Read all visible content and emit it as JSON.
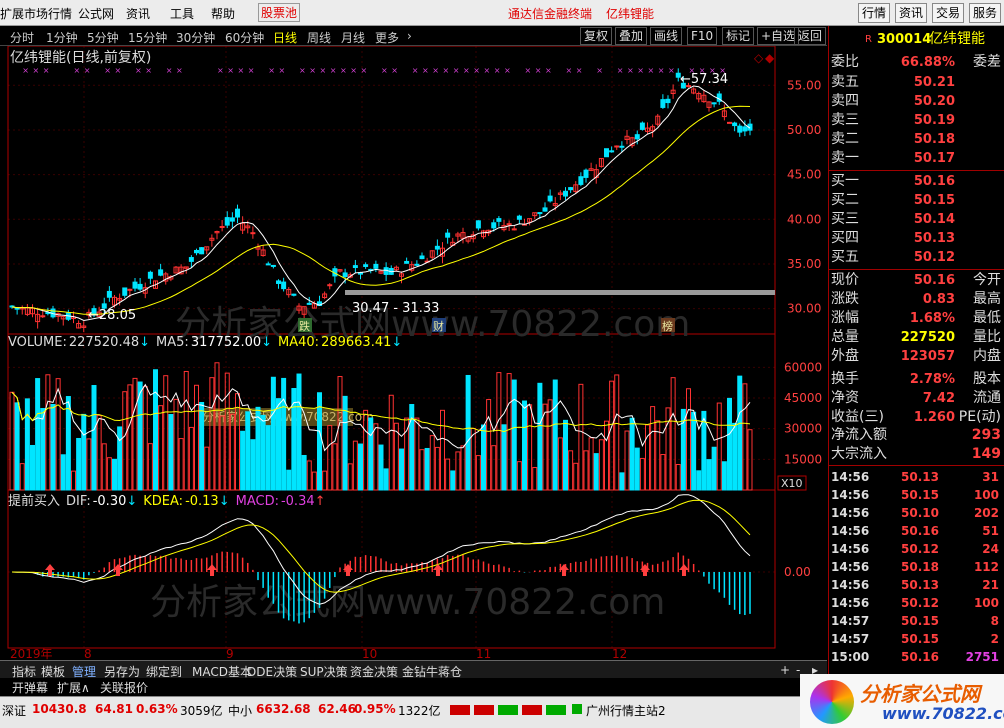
{
  "menu": {
    "items": [
      "扩展市场行情",
      "公式网",
      "资讯",
      "工具",
      "帮助"
    ],
    "hot": "股票池",
    "center_title": "通达信金融终端",
    "center_stock": "亿纬锂能",
    "right_buttons": [
      "行情",
      "资讯",
      "交易",
      "服务"
    ]
  },
  "periods": {
    "items": [
      "分时",
      "1分钟",
      "5分钟",
      "15分钟",
      "30分钟",
      "60分钟",
      "日线",
      "周线",
      "月线",
      "更多"
    ],
    "active": "日线"
  },
  "toolbar": {
    "buttons": [
      "复权",
      "叠加",
      "画线",
      "F10",
      "标记",
      "+自选",
      "返回"
    ]
  },
  "chart": {
    "title": "亿纬锂能(日线,前复权)",
    "high_label": "57.34",
    "low_label": "28.05",
    "range_label": "30.47 - 31.33",
    "marks": [
      "跌",
      "财",
      "榜"
    ],
    "y_ticks": [
      "55.00",
      "50.00",
      "45.00",
      "40.00",
      "35.00",
      "30.00"
    ],
    "watermark": "分析家公式网www.70822.com",
    "watermark_small": "分析家公式网www.70822.com"
  },
  "volume": {
    "label": "VOLUME:",
    "value": "227520.48",
    "ma5_label": "MA5:",
    "ma5": "317752.00",
    "ma40_label": "MA40:",
    "ma40": "289663.41",
    "y_ticks": [
      "60000",
      "45000",
      "30000",
      "15000"
    ],
    "unit": "X10"
  },
  "macd": {
    "title": "提前买入",
    "dif_label": "DIF:",
    "dif": "-0.30",
    "dea_label": "KDEA:",
    "dea": "-0.13",
    "macd_label": "MACD:",
    "macd": "-0.34",
    "y_tick": "0.00"
  },
  "timeline": {
    "labels": [
      "2019年",
      "8",
      "9",
      "10",
      "11",
      "12"
    ]
  },
  "bottom_tabs": {
    "items": [
      "指标",
      "模板",
      "管理",
      "另存为",
      "绑定到",
      "MACD基本",
      "DDE决策",
      "SUP决策",
      "资金决策",
      "金钻牛蒋仓"
    ]
  },
  "bottom2": {
    "items": [
      "开弹幕",
      "扩展∧",
      "关联报价"
    ]
  },
  "status": {
    "sz_label": "深证",
    "sz_value": "10430.8",
    "sz_change": "64.81",
    "sz_pct": "0.63%",
    "sz_amount": "3059亿",
    "zx_label": "中小",
    "zx_value": "6632.68",
    "zx_change": "62.46",
    "zx_pct": "0.95%",
    "zx_amount": "1322亿",
    "server": "广州行情主站2"
  },
  "quote": {
    "code": "300014",
    "name": "亿纬锂能",
    "wei_bi_label": "委比",
    "wei_bi": "66.88%",
    "wei_cha_label": "委差",
    "sells": [
      {
        "label": "卖五",
        "price": "50.21"
      },
      {
        "label": "卖四",
        "price": "50.20"
      },
      {
        "label": "卖三",
        "price": "50.19"
      },
      {
        "label": "卖二",
        "price": "50.18"
      },
      {
        "label": "卖一",
        "price": "50.17"
      }
    ],
    "buys": [
      {
        "label": "买一",
        "price": "50.16"
      },
      {
        "label": "买二",
        "price": "50.15"
      },
      {
        "label": "买三",
        "price": "50.14"
      },
      {
        "label": "买四",
        "price": "50.13"
      },
      {
        "label": "买五",
        "price": "50.12"
      }
    ],
    "stats": [
      {
        "l": "现价",
        "v": "50.16",
        "r": "今开"
      },
      {
        "l": "涨跌",
        "v": "0.83",
        "r": "最高"
      },
      {
        "l": "涨幅",
        "v": "1.68%",
        "r": "最低"
      },
      {
        "l": "总量",
        "v": "227520",
        "r": "量比"
      },
      {
        "l": "外盘",
        "v": "123057",
        "r": "内盘"
      },
      {
        "l": "换手",
        "v": "2.78%",
        "r": "股本"
      },
      {
        "l": "净资",
        "v": "7.42",
        "r": "流通"
      },
      {
        "l": "收益(三)",
        "v": "1.260",
        "r": "PE(动)"
      }
    ],
    "flow": [
      {
        "l": "净流入额",
        "v": "293"
      },
      {
        "l": "大宗流入",
        "v": "149"
      }
    ],
    "ticks": [
      {
        "t": "14:56",
        "p": "50.13",
        "v": "31"
      },
      {
        "t": "14:56",
        "p": "50.15",
        "v": "100"
      },
      {
        "t": "14:56",
        "p": "50.10",
        "v": "202"
      },
      {
        "t": "14:56",
        "p": "50.16",
        "v": "51"
      },
      {
        "t": "14:56",
        "p": "50.12",
        "v": "24"
      },
      {
        "t": "14:56",
        "p": "50.18",
        "v": "112"
      },
      {
        "t": "14:56",
        "p": "50.13",
        "v": "21"
      },
      {
        "t": "14:56",
        "p": "50.12",
        "v": "100"
      },
      {
        "t": "14:57",
        "p": "50.15",
        "v": "8"
      },
      {
        "t": "14:57",
        "p": "50.15",
        "v": "2"
      },
      {
        "t": "15:00",
        "p": "50.16",
        "v": "2751"
      }
    ]
  },
  "logo": {
    "text": "分析家公式网",
    "url": "www.70822.com"
  },
  "colors": {
    "up": "#ff3232",
    "down": "#00e5ff",
    "ma_white": "#ffffff",
    "ma_yellow": "#ffff00",
    "brand": "#e00000"
  }
}
